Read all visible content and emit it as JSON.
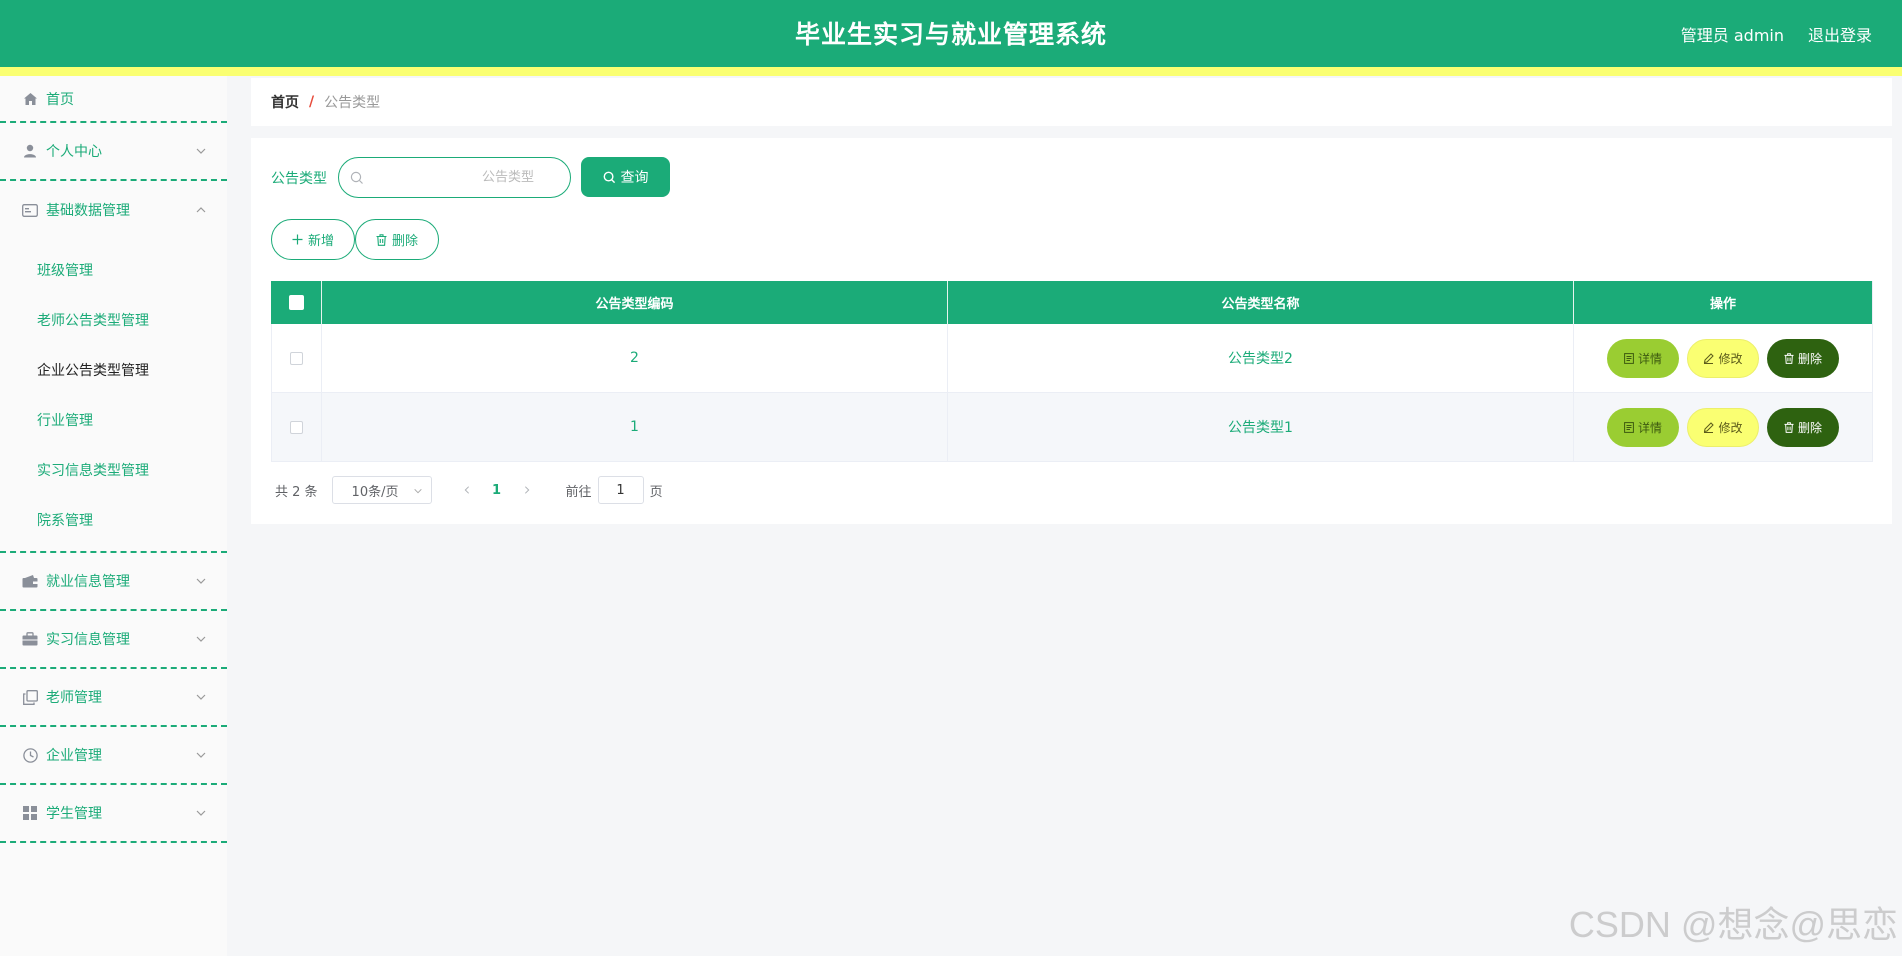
{
  "header": {
    "title": "毕业生实习与就业管理系统",
    "user": "管理员 admin",
    "logout": "退出登录"
  },
  "sidebar": {
    "home": "首页",
    "personal_center": "个人中心",
    "basic_data": {
      "label": "基础数据管理",
      "children": [
        "班级管理",
        "老师公告类型管理",
        "企业公告类型管理",
        "行业管理",
        "实习信息类型管理",
        "院系管理"
      ],
      "active": "企业公告类型管理"
    },
    "employment_info": "就业信息管理",
    "internship_info": "实习信息管理",
    "teacher_mgmt": "老师管理",
    "company_mgmt": "企业管理",
    "student_mgmt": "学生管理"
  },
  "breadcrumb": {
    "home": "首页",
    "separator": "/",
    "current": "公告类型"
  },
  "search": {
    "label": "公告类型",
    "placeholder": "公告类型",
    "query_label": "查询"
  },
  "actions": {
    "add_label": "新增",
    "delete_label": "删除"
  },
  "table": {
    "columns": [
      "公告类型编码",
      "公告类型名称",
      "操作"
    ],
    "rows": [
      {
        "code": "2",
        "name": "公告类型2"
      },
      {
        "code": "1",
        "name": "公告类型1"
      }
    ],
    "row_actions": {
      "detail": "详情",
      "edit": "修改",
      "delete": "删除"
    }
  },
  "pagination": {
    "total_text": "共 2 条",
    "page_size": "10条/页",
    "current_page": "1",
    "goto_prefix": "前往",
    "goto_value": "1",
    "goto_suffix": "页"
  },
  "watermark": "CSDN @想念@思恋",
  "colors": {
    "primary": "#1bab78",
    "stripe": "#faff72",
    "detail_btn": "#9acd32",
    "edit_btn": "#faff72",
    "delete_btn": "#2e6210"
  }
}
